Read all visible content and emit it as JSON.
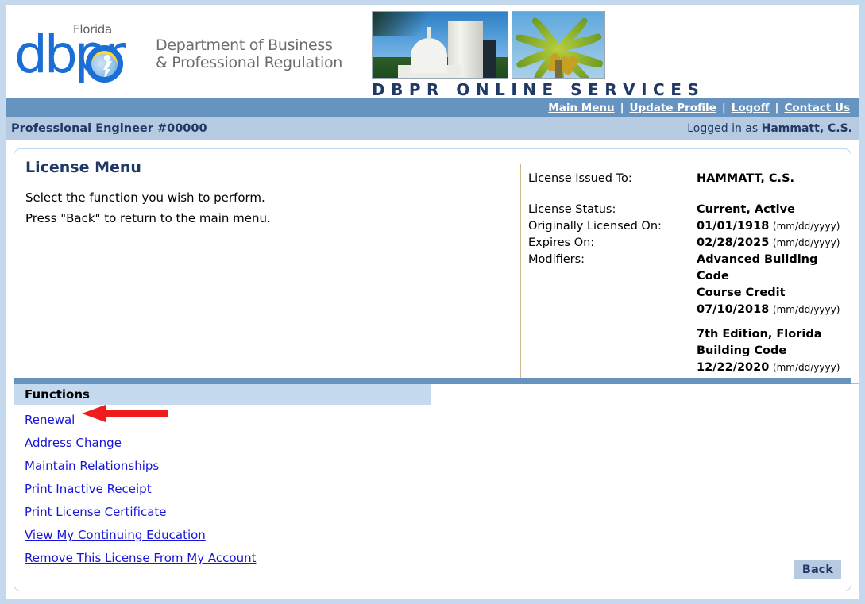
{
  "header": {
    "logo": {
      "florida": "Florida",
      "wordmark": "dbpr",
      "dept_line1": "Department of Business",
      "dept_line2": "& Professional Regulation"
    },
    "banner_text": "DBPR  ONLINE  SERVICES"
  },
  "nav": {
    "items": [
      {
        "label": "Main Menu"
      },
      {
        "label": "Update Profile"
      },
      {
        "label": "Logoff"
      },
      {
        "label": "Contact Us"
      }
    ],
    "separator": "|"
  },
  "userbar": {
    "license_title": "Professional Engineer #00000",
    "logged_in_prefix": "Logged in as ",
    "logged_in_name": "Hammatt, C.S."
  },
  "main": {
    "page_title": "License Menu",
    "instruction_line1": "Select the function you wish to perform.",
    "instruction_line2": "Press \"Back\" to return to the main menu."
  },
  "license_box": {
    "rows": [
      {
        "label": "License Issued To:",
        "value": "HAMMATT, C.S.",
        "format": ""
      },
      {
        "label": "License Status:",
        "value": "Current, Active",
        "format": ""
      },
      {
        "label": "Originally Licensed On:",
        "value": "01/01/1918",
        "format": "(mm/dd/yyyy)"
      },
      {
        "label": "Expires On:",
        "value": "02/28/2025",
        "format": "(mm/dd/yyyy)"
      }
    ],
    "modifiers_label": "Modifiers:",
    "modifiers": [
      {
        "name_line1": "Advanced Building Code",
        "name_line2": "Course Credit",
        "date": "07/10/2018",
        "format": "(mm/dd/yyyy)"
      },
      {
        "name_line1": "7th Edition, Florida",
        "name_line2": "Building Code",
        "date": "12/22/2020",
        "format": "(mm/dd/yyyy)"
      }
    ]
  },
  "functions": {
    "header": "Functions",
    "items": [
      {
        "label": "Renewal"
      },
      {
        "label": "Address Change"
      },
      {
        "label": "Maintain Relationships"
      },
      {
        "label": "Print Inactive Receipt"
      },
      {
        "label": "Print License Certificate"
      },
      {
        "label": "View My Continuing Education"
      },
      {
        "label": "Remove This License From My Account"
      }
    ]
  },
  "footer": {
    "back_label": "Back"
  },
  "annotation": {
    "arrow_color": "#ee1c1c",
    "arrow_target": "Renewal"
  },
  "colors": {
    "nav_bar": "#6693c0",
    "user_bar": "#b6cbe2",
    "page_frame": "#c5d9ee",
    "link": "#1616d8",
    "heading": "#1f3864",
    "license_box_border": "#c9b98b",
    "functions_header": "#c5d9ef"
  }
}
